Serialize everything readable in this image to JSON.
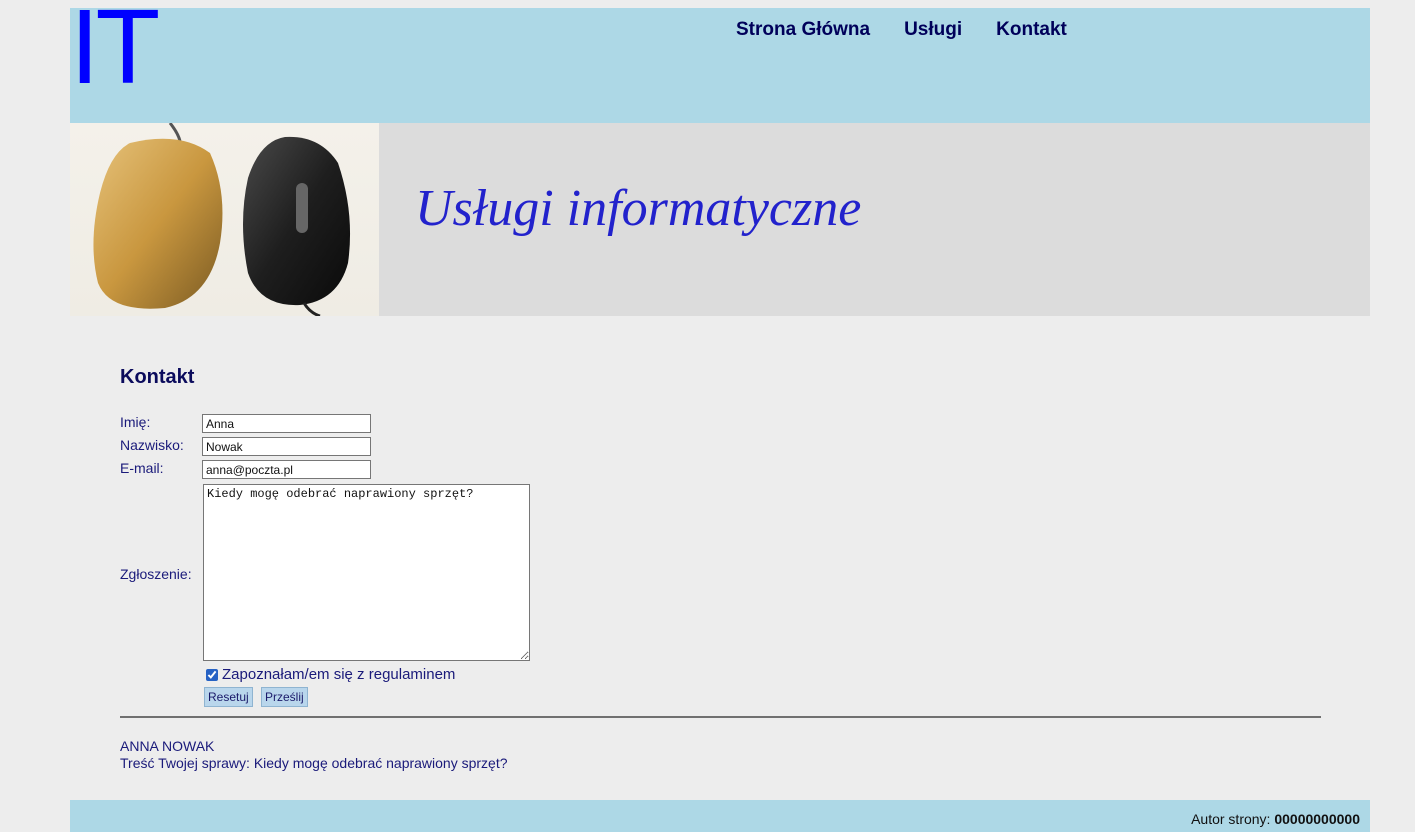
{
  "header": {
    "logo": "IT",
    "nav": [
      "Strona Główna",
      "Usługi",
      "Kontakt"
    ]
  },
  "banner": {
    "title": "Usługi informatyczne",
    "image": "computer-mice-photo"
  },
  "form": {
    "heading": "Kontakt",
    "labels": {
      "first_name": "Imię:",
      "last_name": "Nazwisko:",
      "email": "E-mail:",
      "message": "Zgłoszenie:"
    },
    "values": {
      "first_name": "Anna",
      "last_name": "Nowak",
      "email": "anna@poczta.pl",
      "message": "Kiedy mogę odebrać naprawiony sprzęt?"
    },
    "checkbox_label": "Zapoznałam/em się z regulaminem",
    "checkbox_checked": true,
    "reset_label": "Resetuj",
    "submit_label": "Prześlij"
  },
  "result": {
    "name": "ANNA NOWAK",
    "message_line": "Treść Twojej sprawy: Kiedy mogę odebrać naprawiony sprzęt?"
  },
  "footer": {
    "author_label": "Autor strony:",
    "author_id": "00000000000"
  },
  "colors": {
    "header_bg": "#add8e6",
    "logo": "#0000ff",
    "banner_title": "#2222cc",
    "text": "#1a1a7a"
  }
}
